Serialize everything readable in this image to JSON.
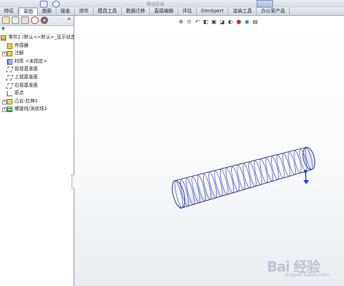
{
  "top_strip": {
    "move_label": "移动实体"
  },
  "tabs": [
    {
      "label": "特征",
      "active": false
    },
    {
      "label": "草图",
      "active": true
    },
    {
      "label": "曲面",
      "active": false
    },
    {
      "label": "钣金",
      "active": false
    },
    {
      "label": "焊件",
      "active": false
    },
    {
      "label": "模具工具",
      "active": false
    },
    {
      "label": "数据迁移",
      "active": false
    },
    {
      "label": "直接编辑",
      "active": false
    },
    {
      "label": "评估",
      "active": false
    },
    {
      "label": "DimXpert",
      "active": false
    },
    {
      "label": "渲染工具",
      "active": false
    },
    {
      "label": "办公室产品",
      "active": false
    }
  ],
  "sidebar": {
    "icons": [
      "feature-manager-icon",
      "property-manager-icon",
      "configuration-manager-icon",
      "dimxpert-manager-icon",
      "display-manager-icon"
    ],
    "expand_glyph": "»",
    "filter_icon": "filter-icon"
  },
  "tree": [
    {
      "label": "零件2  (默认<<默认>_显示状态",
      "icon": "part-icon"
    },
    {
      "label": "传感器",
      "icon": "sensor-icon"
    },
    {
      "label": "注解",
      "icon": "annotation-icon",
      "expandable": true
    },
    {
      "label": "材质 <未指定>",
      "icon": "material-icon"
    },
    {
      "label": "前视基准面",
      "icon": "plane-icon"
    },
    {
      "label": "上视基准面",
      "icon": "plane-icon"
    },
    {
      "label": "右视基准面",
      "icon": "plane-icon"
    },
    {
      "label": "原点",
      "icon": "origin-icon"
    },
    {
      "label": "凸台-拉伸1",
      "icon": "boss-extrude-icon",
      "expandable": true
    },
    {
      "label": "螺旋线/涡状线1",
      "icon": "helix-icon",
      "expandable": true
    }
  ],
  "colors": {
    "accent": "#3a6fd0",
    "helix": "#2a36c8",
    "model_edge": "#1a1a6a",
    "origin_arrow": "#1f3fd8"
  },
  "watermark": {
    "text": "Bai 经验",
    "sub": "jingyan.baidu.com"
  }
}
